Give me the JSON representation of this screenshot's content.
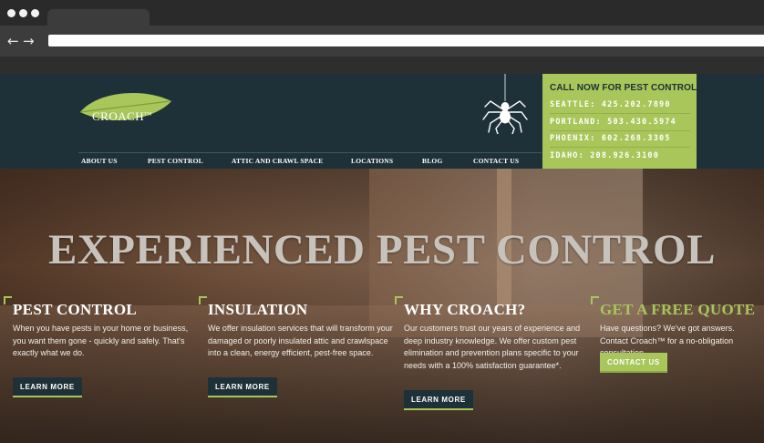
{
  "site": {
    "logo_text": "CROACH",
    "logo_tm": "TM"
  },
  "nav": [
    {
      "label": "ABOUT US"
    },
    {
      "label": "PEST CONTROL"
    },
    {
      "label": "ATTIC AND CRAWL SPACE"
    },
    {
      "label": "LOCATIONS"
    },
    {
      "label": "BLOG"
    },
    {
      "label": "CONTACT US"
    }
  ],
  "call_box": {
    "title": "CALL NOW FOR PEST CONTROL",
    "lines": [
      "SEATTLE: 425.202.7890",
      "PORTLAND: 503.430.5974",
      "PHOENIX: 602.268.3305",
      "IDAHO: 208.926.3100"
    ]
  },
  "hero": {
    "title": "EXPERIENCED PEST CONTROL"
  },
  "columns": [
    {
      "heading": "PEST CONTROL",
      "text": "When you have pests in your home or business, you want them gone - quickly and safely. That's exactly what we do.",
      "button": "LEARN MORE"
    },
    {
      "heading": "INSULATION",
      "text": "We offer insulation services that will transform your damaged or poorly insulated attic and crawlspace into a clean, energy efficient, pest-free space.",
      "button": "LEARN MORE"
    },
    {
      "heading": "WHY CROACH?",
      "text": "Our customers trust our years of experience and deep industry knowledge. We offer custom pest elimination and prevention plans specific to your needs with a 100% satisfaction guarantee*.",
      "button": "LEARN MORE"
    },
    {
      "heading": "GET A FREE QUOTE",
      "text": "Have questions? We've got answers. Contact Croach™ for a no-obligation consultation.",
      "button": "CONTACT US"
    }
  ],
  "colors": {
    "header_bg": "#1f3138",
    "accent_green": "#a8c65a",
    "hero_title": "#c8c2bd"
  },
  "icons": [
    "back-arrow-icon",
    "forward-arrow-icon",
    "leaf-logo-icon",
    "spider-icon"
  ]
}
